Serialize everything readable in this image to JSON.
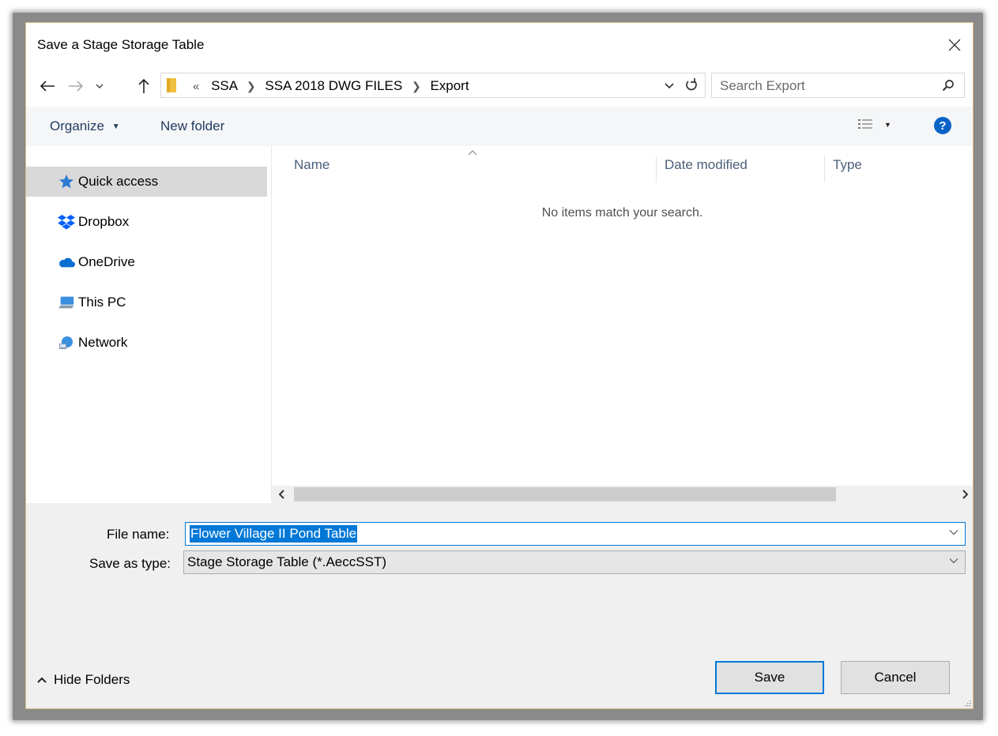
{
  "dialog": {
    "title": "Save a Stage Storage Table"
  },
  "address": {
    "overflow": "«",
    "crumbs": [
      "SSA",
      "SSA 2018 DWG FILES",
      "Export"
    ]
  },
  "search": {
    "placeholder": "Search Export"
  },
  "toolbar": {
    "organize": "Organize",
    "new_folder": "New folder"
  },
  "nav": {
    "items": [
      {
        "label": "Quick access",
        "icon": "star-icon"
      },
      {
        "label": "Dropbox",
        "icon": "dropbox-icon"
      },
      {
        "label": "OneDrive",
        "icon": "cloud-icon"
      },
      {
        "label": "This PC",
        "icon": "computer-icon"
      },
      {
        "label": "Network",
        "icon": "network-icon"
      }
    ]
  },
  "list": {
    "columns": [
      "Name",
      "Date modified",
      "Type"
    ],
    "empty_message": "No items match your search."
  },
  "form": {
    "file_name_label": "File name:",
    "file_name_value": "Flower Village II Pond Table",
    "save_type_label": "Save as type:",
    "save_type_value": "Stage Storage Table (*.AeccSST)"
  },
  "buttons": {
    "save": "Save",
    "cancel": "Cancel",
    "hide_folders": "Hide Folders"
  },
  "colors": {
    "accent": "#0078d7",
    "selection": "#d9d9d9",
    "folder": "#f0c040"
  }
}
